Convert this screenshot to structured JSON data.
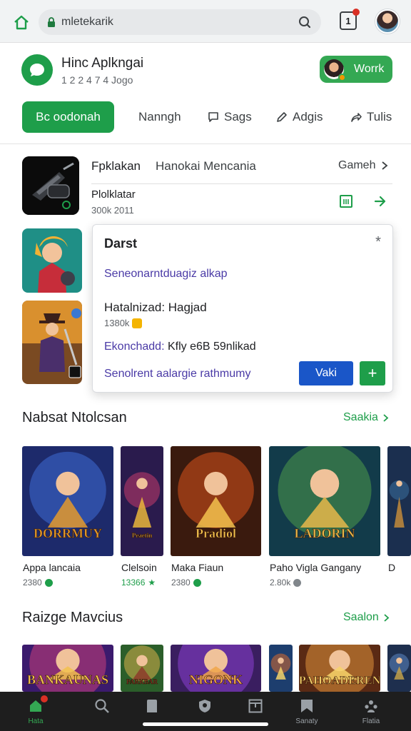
{
  "browser": {
    "url": "mletekarik",
    "tab_count": "1"
  },
  "header": {
    "title": "Hinc Aplkngai",
    "subtitle": "1 2 2 4 7 4 Jogo",
    "work_button": "Worrk"
  },
  "nav": {
    "primary": "Bc oodonah",
    "items": [
      "Nanngh",
      "Sags",
      "Adgis",
      "Tulis"
    ]
  },
  "featured": {
    "title": "Fpklakan",
    "description": "Hanokai Mencania",
    "link": "Gameh",
    "name": "Plolklatar",
    "count": "300k 2011"
  },
  "popup": {
    "title": "Darst",
    "link1": "Seneonarntduagiz alkap",
    "label": "Hatalnizad: Hagjad",
    "count": "1380k",
    "row_label": "Ekonchadd:",
    "row_value": "Kfly e6B 59nlikad",
    "link2": "Senolrent aalargie rathmumy",
    "primary_button": "Vaki",
    "add_button": "+"
  },
  "section1": {
    "title": "Nabsat Ntolcsan",
    "more": "Saakia",
    "cards": [
      {
        "name": "Appa lancaia",
        "meta": "2380",
        "icon": "check-icon",
        "art_title": "DORRMUY",
        "palette": [
          "#1d2a6b",
          "#3e6bd6",
          "#e49a2b"
        ]
      },
      {
        "name": "Clelsoin",
        "meta": "13366",
        "icon": "star-icon",
        "art_title": "Peaetin",
        "palette": [
          "#2a1b4d",
          "#c23a6b",
          "#e9b53b"
        ]
      },
      {
        "name": "Maka Fiaun",
        "meta": "2380",
        "icon": "check-icon",
        "art_title": "Pradiol",
        "palette": [
          "#3a1a0e",
          "#d9541c",
          "#f3c24e"
        ]
      },
      {
        "name": "Paho Vigla Gangany",
        "meta": "2.80k",
        "icon": "grey-icon",
        "art_title": "LADORIN",
        "palette": [
          "#123b4a",
          "#4c9b4a",
          "#e8b84a"
        ]
      },
      {
        "name": "D",
        "meta": "",
        "icon": "grey-icon",
        "art_title": "",
        "palette": [
          "#1b2f4f",
          "#3a6f9e",
          "#c28a3a"
        ]
      }
    ]
  },
  "section2": {
    "title": "Raizge Mavcius",
    "more": "Saalon",
    "cards": [
      {
        "palette": [
          "#3b1a6d",
          "#c93f7a",
          "#f2c14e"
        ],
        "art_title": "BANKAUNAS"
      },
      {
        "palette": [
          "#2b5e2a",
          "#d8b04a",
          "#8c3b2a"
        ],
        "art_title": "PARKBAR"
      },
      {
        "palette": [
          "#3a1e60",
          "#8a3fd1",
          "#f0a64a"
        ],
        "art_title": "NIGONK"
      },
      {
        "palette": [
          "#1d3e6e",
          "#d96a2b",
          "#f3d46a"
        ],
        "art_title": ""
      },
      {
        "palette": [
          "#5a2a14",
          "#e0923a",
          "#f7d36a"
        ],
        "art_title": "PAHOADEREN"
      },
      {
        "palette": [
          "#1e2f4e",
          "#5d86c2",
          "#c2a04a"
        ],
        "art_title": ""
      }
    ]
  },
  "bottom_nav": {
    "items": [
      {
        "label": "Hata",
        "icon": "home-icon"
      },
      {
        "label": "",
        "icon": "search-icon"
      },
      {
        "label": "",
        "icon": "bookmark-icon"
      },
      {
        "label": "",
        "icon": "shield-icon"
      },
      {
        "label": "",
        "icon": "box-icon"
      },
      {
        "label": "Sanaty",
        "icon": "flag-icon"
      },
      {
        "label": "Flatia",
        "icon": "people-icon"
      }
    ]
  },
  "colors": {
    "accent_green": "#1e9e4a",
    "link_purple": "#4a3aa6",
    "primary_blue": "#1a56c8",
    "badge_red": "#d93025"
  }
}
